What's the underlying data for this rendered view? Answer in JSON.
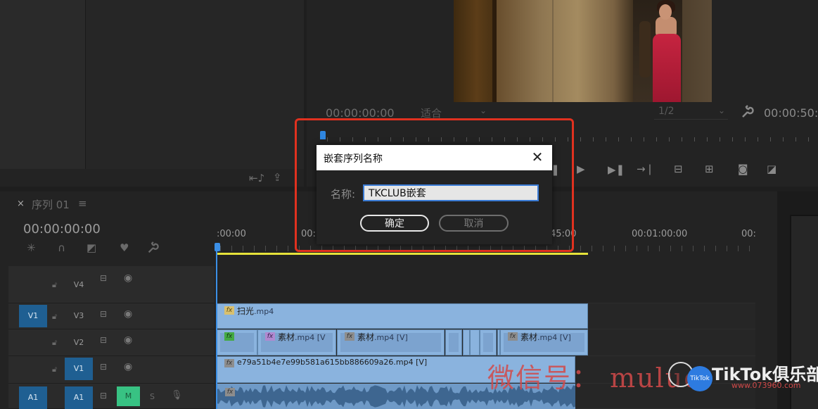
{
  "program_monitor": {
    "timecode_left": "00:00:00:00",
    "fit_dropdown": "适合",
    "resolution_dropdown": "1/2",
    "timecode_right": "00:00:50:"
  },
  "timeline": {
    "sequence_tab": "序列 01",
    "close_glyph": "×",
    "menu_glyph": "≡",
    "timecode": "00:00:00:00",
    "ruler_labels": [
      ":00:00",
      "00:",
      "45:00",
      "00:01:00:00",
      "00:"
    ],
    "tracks": [
      {
        "name": "V4",
        "source": "",
        "targeted": false
      },
      {
        "name": "V3",
        "source": "V1",
        "targeted": false
      },
      {
        "name": "V2",
        "source": "",
        "targeted": false
      },
      {
        "name": "V1",
        "source": "",
        "targeted": true
      },
      {
        "name": "A1",
        "source": "A1",
        "targeted": true
      }
    ],
    "mute_label": "M",
    "solo_label": "S",
    "clips": {
      "v3_clip": "扫光",
      "v3_ext": ".mp4",
      "v2_clip_a": "素材",
      "v2_clip_a_ext": ".mp4 [V",
      "v2_clip_b": "素材",
      "v2_clip_b_ext": ".mp4 [V]",
      "v2_clip_c": "素材",
      "v2_clip_c_ext": ".mp4 [V]",
      "v1_clip": "e79a51b4e7e99b581a615bb886609a26.mp4 [V]",
      "fx_label": "fx"
    }
  },
  "dialog": {
    "title": "嵌套序列名称",
    "close_glyph": "✕",
    "name_label": "名称:",
    "name_value": "TKCLUB嵌套",
    "ok_label": "确定",
    "cancel_label": "取消"
  },
  "watermark": {
    "wechat": "微信号： muluo",
    "tiktok_badge": "TikTok",
    "brand": "TikTok俱乐部培训",
    "url": "www.073960.com"
  },
  "colors": {
    "highlight": "#e0311f",
    "track_target": "#1f5f92",
    "clip": "#8ab3de",
    "workbar": "#e5e23a",
    "mute": "#38c283"
  }
}
